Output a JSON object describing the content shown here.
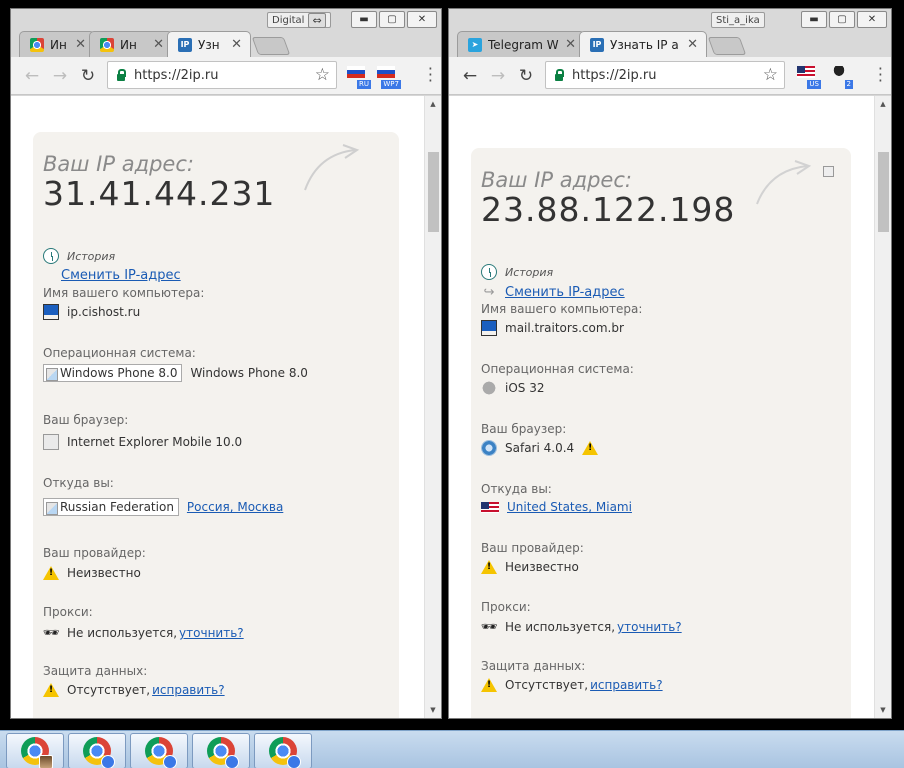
{
  "left_window": {
    "profile_badge": "Digital",
    "tabs": [
      {
        "label": "Ин",
        "favicon": "chrome-icon"
      },
      {
        "label": "Ин",
        "favicon": "chrome-icon"
      },
      {
        "label": "Узн",
        "favicon": "ip-icon",
        "active": true
      }
    ],
    "url": "https://2ip.ru",
    "extensions": [
      {
        "badge": "RU",
        "icon": "flag-ru"
      },
      {
        "badge": "WP7",
        "icon": "flag-ru"
      }
    ],
    "page": {
      "ip_label": "Ваш IP адрес:",
      "ip_value": "31.41.44.231",
      "history_label": "История",
      "change_ip_link": "Сменить IP-адрес",
      "computer_name_caption": "Имя вашего компьютера:",
      "computer_name": "ip.cishost.ru",
      "os_caption": "Операционная система:",
      "os_image_alt": "Windows Phone 8.0",
      "os_value": "Windows Phone 8.0",
      "browser_caption": "Ваш браузер:",
      "browser_value": "Internet Explorer Mobile 10.0",
      "location_caption": "Откуда вы:",
      "location_image_alt": "Russian Federation",
      "location_link": "Россия, Москва",
      "provider_caption": "Ваш провайдер:",
      "provider_value": "Неизвестно",
      "proxy_caption": "Прокси:",
      "proxy_value": "Не используется,",
      "proxy_link": "уточнить?",
      "protection_caption": "Защита данных:",
      "protection_value": "Отсутствует,",
      "protection_link": "исправить?"
    }
  },
  "right_window": {
    "profile_badge": "Sti_a_ika",
    "tabs": [
      {
        "label": "Telegram W",
        "favicon": "telegram-icon"
      },
      {
        "label": "Узнать IP а",
        "favicon": "ip-icon",
        "active": true
      }
    ],
    "url": "https://2ip.ru",
    "extensions": [
      {
        "badge": "US",
        "icon": "flag-us"
      },
      {
        "badge": "2",
        "icon": "spy-icon"
      }
    ],
    "page": {
      "ip_label": "Ваш IP адрес:",
      "ip_value": "23.88.122.198",
      "history_label": "История",
      "change_ip_link": "Сменить IP-адрес",
      "computer_name_caption": "Имя вашего компьютера:",
      "computer_name": "mail.traitors.com.br",
      "os_caption": "Операционная система:",
      "os_value": "iOS 32",
      "browser_caption": "Ваш браузер:",
      "browser_value": "Safari 4.0.4",
      "location_caption": "Откуда вы:",
      "location_link": "United States, Miami",
      "provider_caption": "Ваш провайдер:",
      "provider_value": "Неизвестно",
      "proxy_caption": "Прокси:",
      "proxy_value": "Не используется,",
      "proxy_link": "уточнить?",
      "protection_caption": "Защита данных:",
      "protection_value": "Отсутствует,",
      "protection_link": "исправить?"
    }
  },
  "taskbar": {
    "items": [
      {
        "icon": "chrome-icon",
        "avatar": "photo"
      },
      {
        "icon": "chrome-icon",
        "avatar": "person"
      },
      {
        "icon": "chrome-icon",
        "avatar": "person"
      },
      {
        "icon": "chrome-icon",
        "avatar": "person"
      },
      {
        "icon": "chrome-icon",
        "avatar": "person"
      }
    ]
  },
  "colors": {
    "link": "#1a5bb4",
    "card_bg": "#f4f2ee",
    "secure_green": "#0b8043",
    "taskbar": "#b9d0e8"
  }
}
